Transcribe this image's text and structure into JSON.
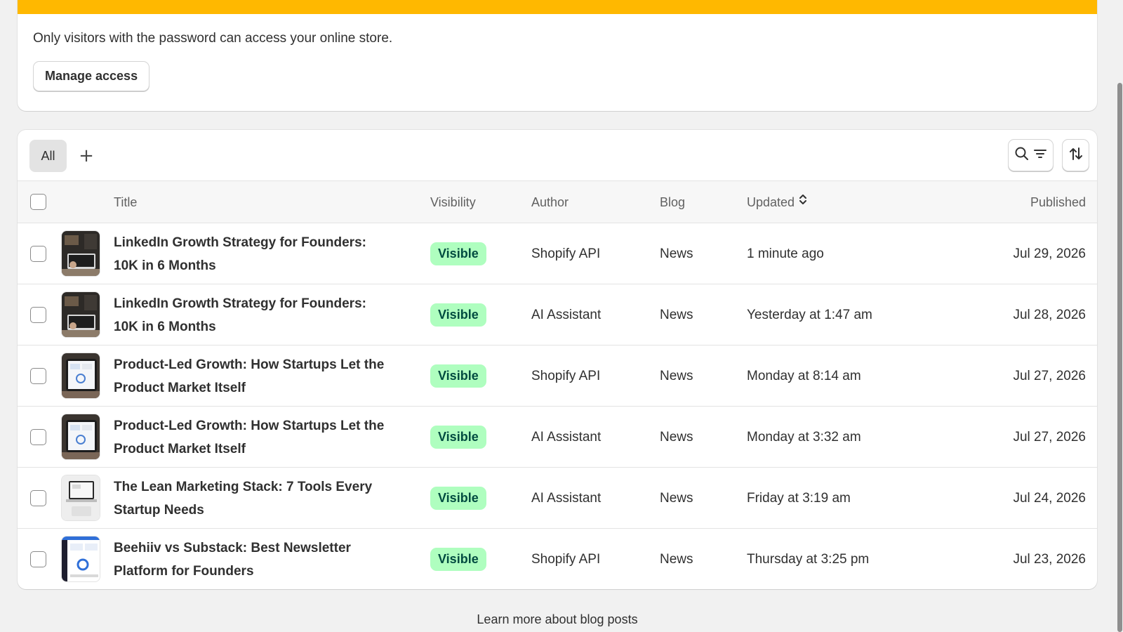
{
  "banner": {
    "color": "#ffb800",
    "message": "Only visitors with the password can access your online store.",
    "button_label": "Manage access"
  },
  "toolbar": {
    "tabs": [
      {
        "label": "All",
        "selected": true
      }
    ],
    "add_tab_label": "+",
    "search_filter_icon": "search-filter-icon",
    "sort_icon": "sort-arrows-icon"
  },
  "table": {
    "headers": {
      "title": "Title",
      "visibility": "Visibility",
      "author": "Author",
      "blog": "Blog",
      "updated": "Updated",
      "published": "Published"
    },
    "rows": [
      {
        "title": "LinkedIn Growth Strategy for Founders: 10K in 6 Months",
        "visibility": "Visible",
        "author": "Shopify API",
        "blog": "News",
        "updated": "1 minute ago",
        "published": "Jul 29, 2026",
        "thumb": "person-laptop"
      },
      {
        "title": "LinkedIn Growth Strategy for Founders: 10K in 6 Months",
        "visibility": "Visible",
        "author": "AI Assistant",
        "blog": "News",
        "updated": "Yesterday at 1:47 am",
        "published": "Jul 28, 2026",
        "thumb": "person-laptop"
      },
      {
        "title": "Product-Led Growth: How Startups Let the Product Market Itself",
        "visibility": "Visible",
        "author": "Shopify API",
        "blog": "News",
        "updated": "Monday at 8:14 am",
        "published": "Jul 27, 2026",
        "thumb": "tablet-dashboard"
      },
      {
        "title": "Product-Led Growth: How Startups Let the Product Market Itself",
        "visibility": "Visible",
        "author": "AI Assistant",
        "blog": "News",
        "updated": "Monday at 3:32 am",
        "published": "Jul 27, 2026",
        "thumb": "tablet-dashboard"
      },
      {
        "title": "The Lean Marketing Stack: 7 Tools Every Startup Needs",
        "visibility": "Visible",
        "author": "AI Assistant",
        "blog": "News",
        "updated": "Friday at 3:19 am",
        "published": "Jul 24, 2026",
        "thumb": "laptop-desk"
      },
      {
        "title": "Beehiiv vs Substack: Best Newsletter Platform for Founders",
        "visibility": "Visible",
        "author": "Shopify API",
        "blog": "News",
        "updated": "Thursday at 3:25 pm",
        "published": "Jul 23, 2026",
        "thumb": "dashboard-screenshot"
      }
    ]
  },
  "footer": {
    "link_text": "Learn more about blog posts"
  }
}
